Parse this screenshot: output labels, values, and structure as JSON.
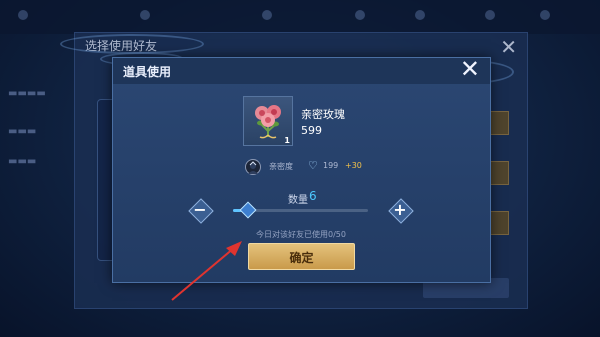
{
  "background": {
    "panel_title": "选择使用好友",
    "close_glyph": "✕"
  },
  "dialog": {
    "title": "道具使用",
    "close_glyph": "✕",
    "item": {
      "name": "亲密玫瑰",
      "value": "599",
      "count": "1"
    },
    "affinity": {
      "label": "亲密度",
      "base": "199",
      "bonus": "+30"
    },
    "quantity": {
      "label": "数量",
      "value": "6",
      "slider_fraction": 0.1
    },
    "minus_glyph": "−",
    "plus_glyph": "+",
    "usage_text": "今日对该好友已使用0/50",
    "confirm_label": "确定"
  },
  "colors": {
    "accent_blue": "#4cc9ff",
    "bonus_gold": "#f1c14b",
    "confirm_gold": "#d6ad62",
    "arrow_red": "#e0342f"
  },
  "icons": {
    "item": "rose-bouquet-icon",
    "affinity": "heart-icon",
    "avatar": "avatar-icon"
  }
}
